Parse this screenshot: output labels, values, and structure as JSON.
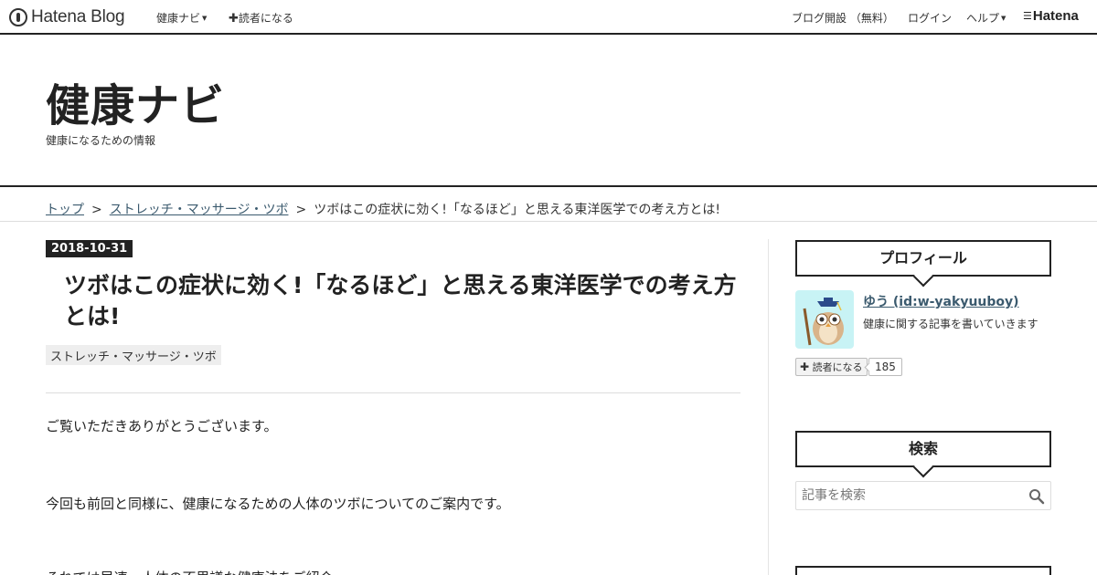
{
  "topbar": {
    "logo_text": "Hatena Blog",
    "blog_menu_label": "健康ナビ",
    "subscribe_label": "読者になる",
    "open_blog_label": "ブログ開設 （無料）",
    "login_label": "ログイン",
    "help_label": "ヘルプ",
    "hatena_label": "Hatena"
  },
  "header": {
    "title": "健康ナビ",
    "description": "健康になるための情報"
  },
  "breadcrumb": {
    "items": [
      "トップ",
      "ストレッチ・マッサージ・ツボ",
      "ツボはこの症状に効く!「なるほど」と思える東洋医学での考え方とは!"
    ],
    "separator": ">"
  },
  "entry": {
    "date": "2018-10-31",
    "title": "ツボはこの症状に効く!「なるほど」と思える東洋医学での考え方とは!",
    "category": "ストレッチ・マッサージ・ツボ",
    "paragraphs": [
      "ご覧いただきありがとうございます。",
      "今回も前回と同様に、健康になるための人体のツボについてのご案内です。",
      "それでは早速、人体の不思議な健康法をご紹介"
    ]
  },
  "sidebar": {
    "profile": {
      "title": "プロフィール",
      "name": "ゆう (id:w-yakyuuboy)",
      "description": "健康に関する記事を書いていきます",
      "subscribe_label": "読者になる",
      "subscriber_count": "185"
    },
    "search": {
      "title": "検索",
      "placeholder": "記事を検索"
    }
  },
  "colors": {
    "link": "#3b5a6e",
    "border": "#222222",
    "avatar_bg": "#c8f3f5"
  },
  "icons": {
    "logo": "hatena-blog-logo-icon",
    "search": "search-icon",
    "plus": "plus-icon",
    "caret": "caret-down-icon"
  }
}
